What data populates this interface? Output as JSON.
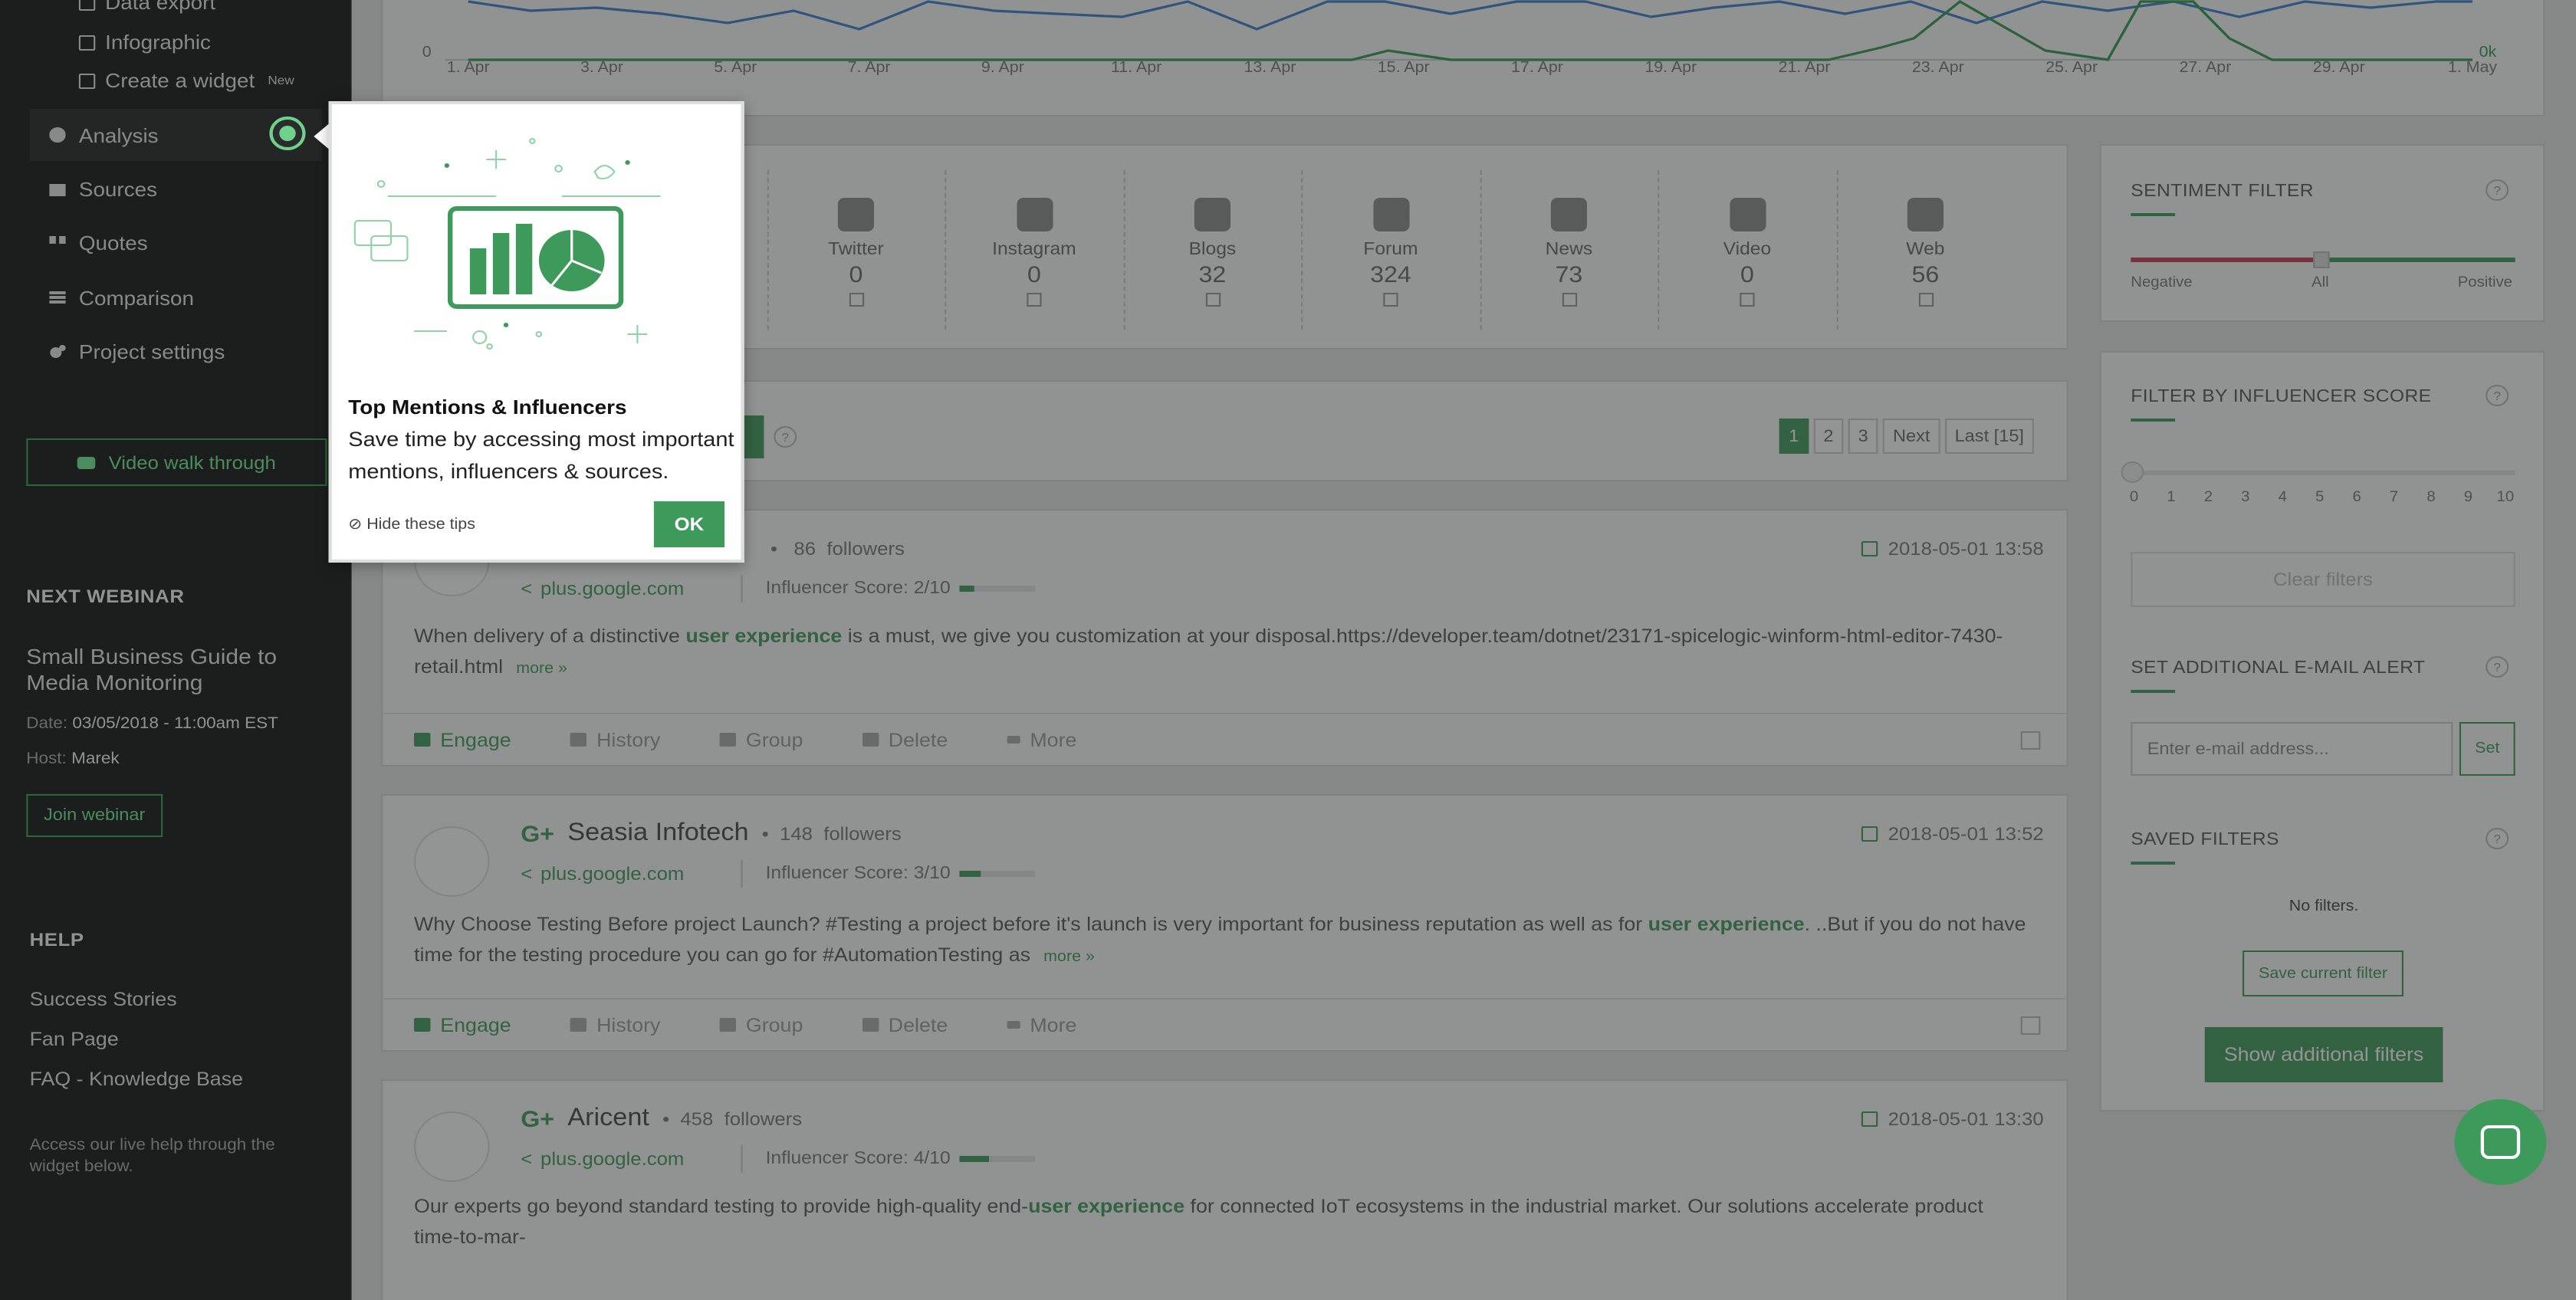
{
  "sidebar": {
    "sub_items": [
      {
        "label": "Data export",
        "icon": "export-icon"
      },
      {
        "label": "Infographic",
        "icon": "infographic-icon"
      },
      {
        "label": "Create a widget",
        "badge": "New",
        "icon": "widget-icon"
      }
    ],
    "nav": [
      {
        "label": "Analysis",
        "icon": "pie-chart-icon",
        "active": true
      },
      {
        "label": "Sources",
        "icon": "briefcase-icon"
      },
      {
        "label": "Quotes",
        "icon": "quote-icon"
      },
      {
        "label": "Comparison",
        "icon": "comparison-icon"
      },
      {
        "label": "Project settings",
        "icon": "gears-icon"
      }
    ],
    "video_button": "Video walk through",
    "webinar": {
      "heading": "NEXT WEBINAR",
      "title": "Small Business Guide to Media Monitoring",
      "date_label": "Date:",
      "date_value": "03/05/2018 - 11:00am EST",
      "host_label": "Host:",
      "host_value": "Marek",
      "join_button": "Join webinar"
    },
    "help": {
      "heading": "HELP",
      "links": [
        "Success Stories",
        "Fan Page",
        "FAQ - Knowledge Base"
      ],
      "footer": "Access our live help through the widget below."
    }
  },
  "chart": {
    "y_left_zero": "0",
    "y_right_zero": "0k",
    "x_ticks": [
      "1. Apr",
      "3. Apr",
      "5. Apr",
      "7. Apr",
      "9. Apr",
      "11. Apr",
      "13. Apr",
      "15. Apr",
      "17. Apr",
      "19. Apr",
      "21. Apr",
      "23. Apr",
      "25. Apr",
      "27. Apr",
      "29. Apr",
      "1. May"
    ],
    "blue_color": "#3b7fd0",
    "green_color": "#2f9a4c"
  },
  "sources": [
    {
      "label": "Twitter",
      "count": "0",
      "icon": "twitter-icon"
    },
    {
      "label": "Instagram",
      "count": "0",
      "icon": "instagram-icon"
    },
    {
      "label": "Blogs",
      "count": "32",
      "icon": "rss-icon"
    },
    {
      "label": "Forum",
      "count": "324",
      "icon": "forum-icon"
    },
    {
      "label": "News",
      "count": "73",
      "icon": "news-icon"
    },
    {
      "label": "Video",
      "count": "0",
      "icon": "youtube-icon"
    },
    {
      "label": "Web",
      "count": "56",
      "icon": "share-icon"
    }
  ],
  "pager": {
    "pages": [
      "1",
      "2",
      "3"
    ],
    "next": "Next",
    "last": "Last [15]",
    "help": "?"
  },
  "posts": [
    {
      "name": "",
      "followers": "86",
      "followers_label": "followers",
      "source": "plus.google.com",
      "score_label": "Influencer Score: 2/10",
      "score": 0.2,
      "date": "2018-05-01 13:58",
      "text_before": "When delivery of a distinctive ",
      "highlight": "user experience",
      "text_after": " is a must, we give you customization at your disposal.https://developer.team/dotnet/23171-spicelogic-winform-html-editor-7430-retail.html",
      "more": "more »"
    },
    {
      "name": "Seasia Infotech",
      "followers": "148",
      "followers_label": "followers",
      "source": "plus.google.com",
      "score_label": "Influencer Score: 3/10",
      "score": 0.3,
      "date": "2018-05-01 13:52",
      "text_before": "Why Choose Testing Before project Launch? #Testing a project before it's launch is very important for business reputation as well as for ",
      "highlight": "user experience",
      "text_after": ". ..But if you do not have time for the testing procedure you can go for #AutomationTesting as",
      "more": "more »"
    },
    {
      "name": "Aricent",
      "followers": "458",
      "followers_label": "followers",
      "source": "plus.google.com",
      "score_label": "Influencer Score: 4/10",
      "score": 0.4,
      "date": "2018-05-01 13:30",
      "text_before": "Our experts go beyond standard testing to provide high-quality end-",
      "highlight": "user experience",
      "text_after": " for connected IoT ecosystems in the industrial market. Our solutions accelerate product time-to-mar-",
      "more": ""
    }
  ],
  "actions": {
    "engage": "Engage",
    "history": "History",
    "group": "Group",
    "delete": "Delete",
    "more": "More"
  },
  "filters": {
    "sentiment": {
      "title": "SENTIMENT FILTER",
      "neg": "Negative",
      "all": "All",
      "pos": "Positive",
      "neg_color": "#c93b52",
      "pos_color": "#3e9a5b"
    },
    "influencer": {
      "title": "FILTER BY INFLUENCER SCORE",
      "ticks": [
        "0",
        "1",
        "2",
        "3",
        "4",
        "5",
        "6",
        "7",
        "8",
        "9",
        "10"
      ],
      "value": 0
    },
    "clear": "Clear filters",
    "email": {
      "title": "SET ADDITIONAL E-MAIL ALERT",
      "placeholder": "Enter e-mail address...",
      "button": "Set"
    },
    "saved": {
      "title": "SAVED FILTERS",
      "empty": "No filters.",
      "save_button": "Save current filter"
    },
    "show_more": "Show additional filters",
    "help": "?"
  },
  "tip": {
    "title": "Top Mentions & Influencers",
    "text": "Save time by accessing most important mentions, influencers & sources.",
    "hide": "⊘ Hide these tips",
    "ok": "OK"
  },
  "accent": "#3e9a5b"
}
